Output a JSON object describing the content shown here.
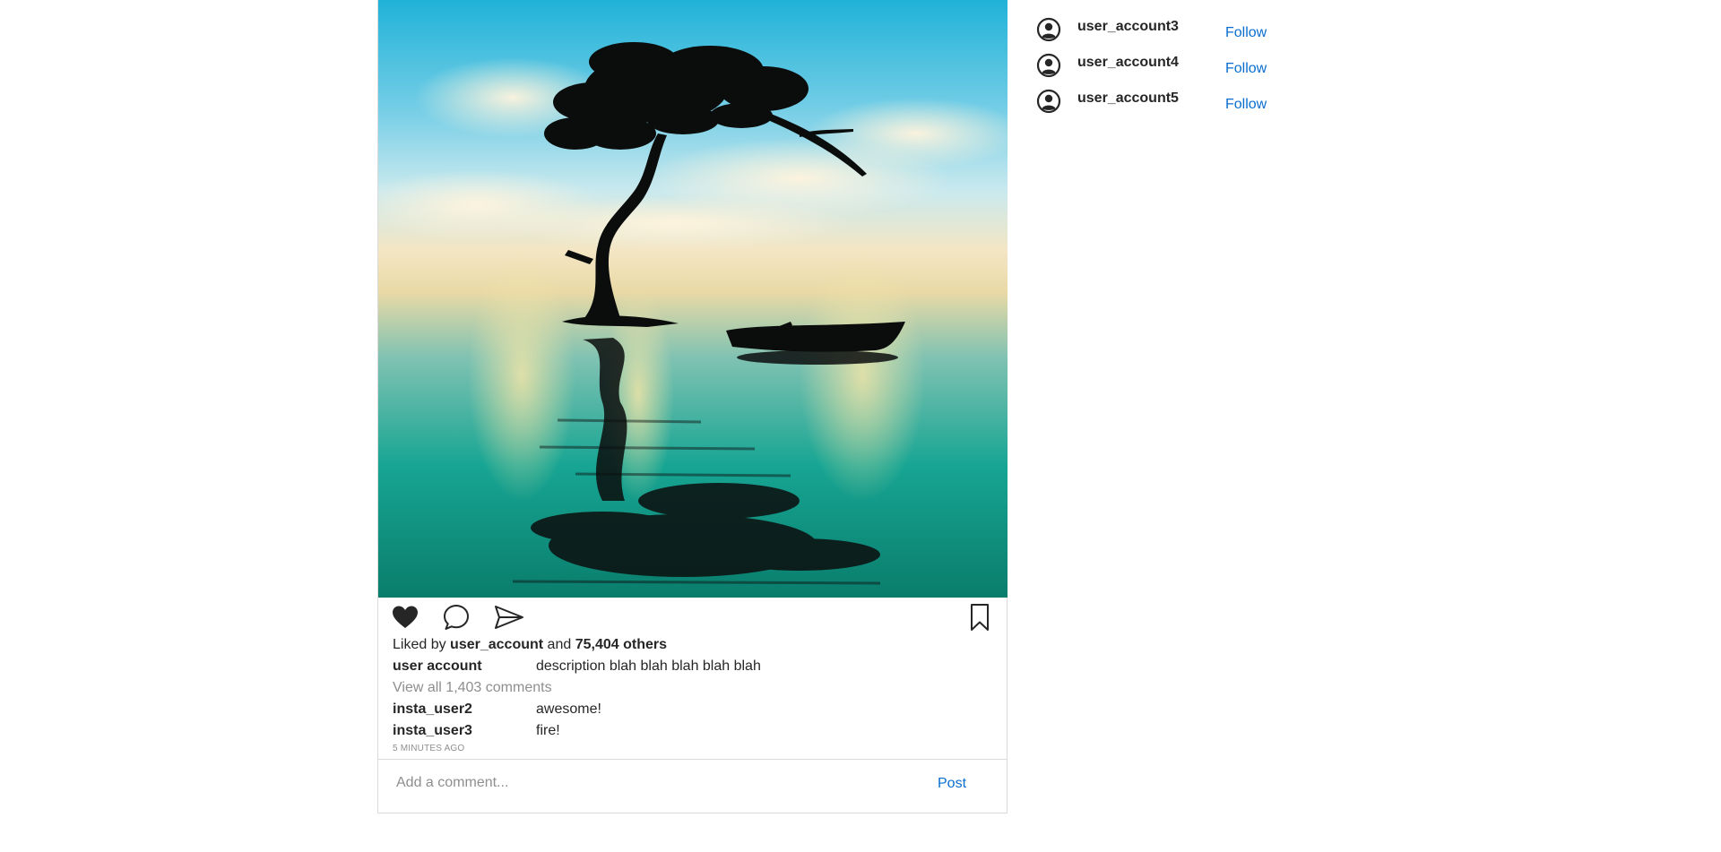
{
  "post": {
    "actions": {
      "like_icon": "heart-filled-icon",
      "comment_icon": "speech-bubble-icon",
      "share_icon": "paper-plane-icon",
      "save_icon": "bookmark-icon"
    },
    "likes": {
      "prefix": "Liked by",
      "user": "user_account",
      "middle": "and",
      "count": "75,404 others"
    },
    "caption": {
      "user": "user account",
      "text": "description blah blah blah blah blah"
    },
    "view_all_comments": "View all 1,403 comments",
    "comments": [
      {
        "user": "insta_user2",
        "text": "awesome!"
      },
      {
        "user": "insta_user3",
        "text": "fire!"
      }
    ],
    "timestamp": "5 minutes ago",
    "comment_placeholder": "Add a comment...",
    "post_label": "Post"
  },
  "suggestions": [
    {
      "username": "user_account3",
      "action": "Follow"
    },
    {
      "username": "user_account4",
      "action": "Follow"
    },
    {
      "username": "user_account5",
      "action": "Follow"
    }
  ],
  "colors": {
    "link_blue": "#0a6ed1",
    "text_dark": "#262626",
    "text_muted": "#8e8e8e",
    "border": "#dbdbdb"
  }
}
